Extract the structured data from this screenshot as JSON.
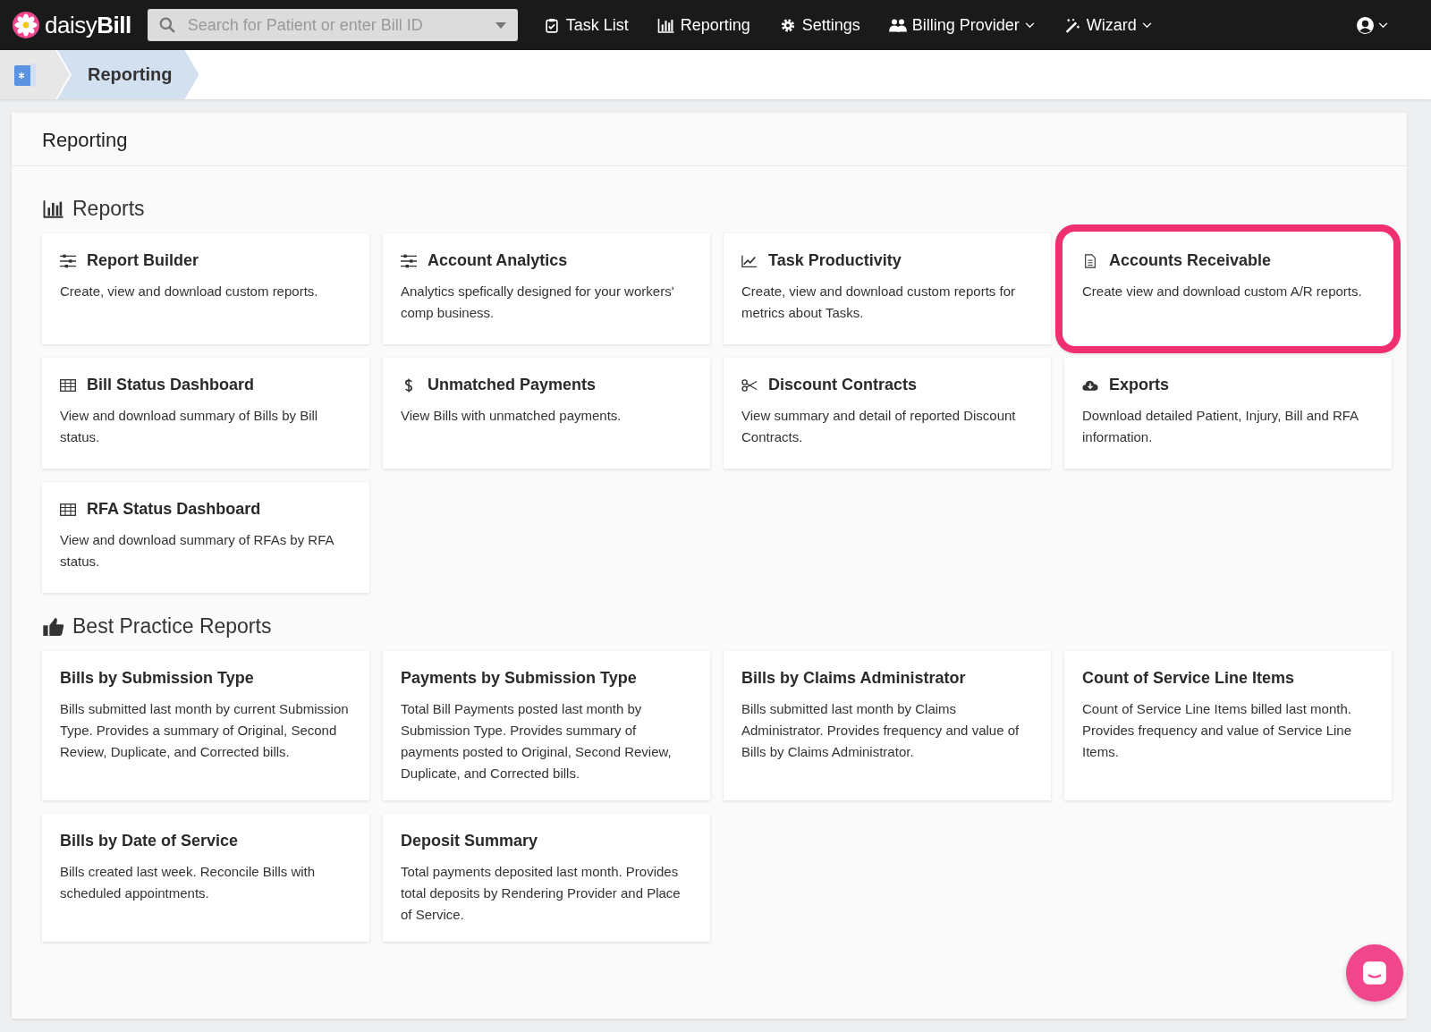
{
  "navbar": {
    "logo": "daisy**Bill**",
    "search": {
      "placeholder": "Search for Patient or enter Bill ID"
    },
    "items": [
      {
        "label": "Task List",
        "kind": "clipboard",
        "dropdown": false
      },
      {
        "label": "Reporting",
        "kind": "barchart",
        "dropdown": false
      },
      {
        "label": "Settings",
        "kind": "gear",
        "dropdown": false
      },
      {
        "label": "Billing Provider",
        "kind": "people",
        "dropdown": true
      },
      {
        "label": "Wizard",
        "kind": "wand",
        "dropdown": true
      }
    ]
  },
  "breadcrumb": [
    "Reporting"
  ],
  "page": {
    "title": "Reporting",
    "sections": [
      {
        "title": "Reports",
        "kind": "barchart",
        "cards": [
          {
            "title": "Report Builder",
            "kind": "sliders",
            "description": "Create, view and download custom reports.",
            "highlighted": false
          },
          {
            "title": "Account Analytics",
            "kind": "sliders",
            "description": "Analytics spefically designed for your workers' comp business.",
            "highlighted": false
          },
          {
            "title": "Task Productivity",
            "kind": "linechart",
            "description": "Create, view and download custom reports for metrics about Tasks.",
            "highlighted": false
          },
          {
            "title": "Accounts Receivable",
            "kind": "document",
            "description": "Create view and download custom A/R reports.",
            "highlighted": true
          },
          {
            "title": "Bill Status Dashboard",
            "kind": "table",
            "description": "View and download summary of Bills by Bill status.",
            "highlighted": false
          },
          {
            "title": "Unmatched Payments",
            "kind": "dollar",
            "description": "View Bills with unmatched payments.",
            "highlighted": false
          },
          {
            "title": "Discount Contracts",
            "kind": "scissors",
            "description": "View summary and detail of reported Discount Contracts.",
            "highlighted": false
          },
          {
            "title": "Exports",
            "kind": "download",
            "description": "Download detailed Patient, Injury, Bill and RFA information.",
            "highlighted": false
          },
          {
            "title": "RFA Status Dashboard",
            "kind": "table",
            "description": "View and download summary of RFAs by RFA status.",
            "highlighted": false
          }
        ]
      },
      {
        "title": "Best Practice Reports",
        "kind": "thumbsup",
        "cards": [
          {
            "title": "Bills by Submission Type",
            "description": "Bills submitted last month by current Submission Type. Provides a summary of Original, Second Review, Duplicate, and Corrected bills.",
            "highlighted": false
          },
          {
            "title": "Payments by Submission Type",
            "description": "Total Bill Payments posted last month by Submission Type. Provides summary of payments posted to Original, Second Review, Duplicate, and Corrected bills.",
            "highlighted": false
          },
          {
            "title": "Bills by Claims Administrator",
            "description": "Bills submitted last month by Claims Administrator. Provides frequency and value of Bills by Claims Administrator.",
            "highlighted": false
          },
          {
            "title": "Count of Service Line Items",
            "description": "Count of Service Line Items billed last month. Provides frequency and value of Service Line Items.",
            "highlighted": false
          },
          {
            "title": "Bills by Date of Service",
            "description": "Bills created last week. Reconcile Bills with scheduled appointments.",
            "highlighted": false
          },
          {
            "title": "Deposit Summary",
            "description": "Total payments deposited last month. Provides total deposits by Rendering Provider and Place of Service.",
            "highlighted": false
          }
        ]
      }
    ]
  }
}
